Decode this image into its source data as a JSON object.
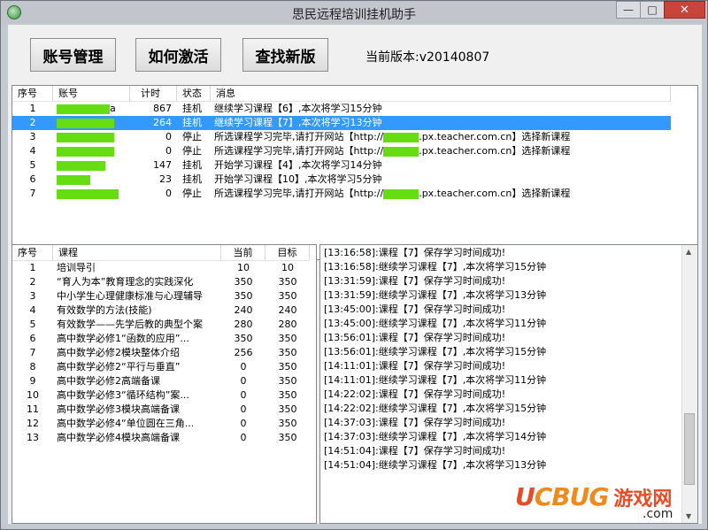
{
  "window": {
    "title": "思民远程培训挂机助手",
    "min_glyph": "—",
    "max_glyph": "□",
    "close_glyph": "✕"
  },
  "toolbar": {
    "account_button": "账号管理",
    "activate_button": "如何激活",
    "update_button": "查找新版",
    "version_label": "当前版本:v20140807"
  },
  "accounts": {
    "headers": [
      "序号",
      "账号",
      "计时",
      "状态",
      "消息"
    ],
    "rows": [
      {
        "no": "1",
        "account_suffix": "a",
        "timer": "867",
        "status": "挂机",
        "message": "继续学习课程【6】,本次将学习15分钟",
        "selected": false
      },
      {
        "no": "2",
        "account_suffix": "",
        "timer": "264",
        "status": "挂机",
        "message": "继续学习课程【7】,本次将学习13分钟",
        "selected": true
      },
      {
        "no": "3",
        "account_suffix": "",
        "timer": "0",
        "status": "停止",
        "message": "所选课程学习完毕,请打开网站【http://          .px.teacher.com.cn】选择新课程",
        "selected": false
      },
      {
        "no": "4",
        "account_suffix": "",
        "timer": "0",
        "status": "停止",
        "message": "所选课程学习完毕,请打开网站【http://          .px.teacher.com.cn】选择新课程",
        "selected": false
      },
      {
        "no": "5",
        "account_suffix": "",
        "timer": "147",
        "status": "挂机",
        "message": "开始学习课程【4】,本次将学习14分钟",
        "selected": false
      },
      {
        "no": "6",
        "account_suffix": "",
        "timer": "23",
        "status": "挂机",
        "message": "开始学习课程【10】,本次将学习5分钟",
        "selected": false
      },
      {
        "no": "7",
        "account_suffix": "",
        "timer": "0",
        "status": "停止",
        "message": "所选课程学习完毕,请打开网站【http://          .px.teacher.com.cn】选择新课程",
        "selected": false
      }
    ]
  },
  "courses": {
    "headers": [
      "序号",
      "课程",
      "当前",
      "目标"
    ],
    "rows": [
      {
        "no": "1",
        "name": "培训导引",
        "current": "10",
        "target": "10"
      },
      {
        "no": "2",
        "name": "“育人为本”教育理念的实践深化",
        "current": "350",
        "target": "350"
      },
      {
        "no": "3",
        "name": "中小学生心理健康标准与心理辅导",
        "current": "350",
        "target": "350"
      },
      {
        "no": "4",
        "name": "有效数学的方法(技能)",
        "current": "240",
        "target": "240"
      },
      {
        "no": "5",
        "name": "有效数学——先学后教的典型个案",
        "current": "280",
        "target": "280"
      },
      {
        "no": "6",
        "name": "高中数学必修1“函数的应用”...",
        "current": "350",
        "target": "350"
      },
      {
        "no": "7",
        "name": "高中数学必修2模块整体介绍",
        "current": "256",
        "target": "350"
      },
      {
        "no": "8",
        "name": "高中数学必修2“平行与垂直”",
        "current": "0",
        "target": "350"
      },
      {
        "no": "9",
        "name": "高中数学必修2高端备课",
        "current": "0",
        "target": "350"
      },
      {
        "no": "10",
        "name": "高中数学必修3“循环结构”案...",
        "current": "0",
        "target": "350"
      },
      {
        "no": "11",
        "name": "高中数学必修3模块高端备课",
        "current": "0",
        "target": "350"
      },
      {
        "no": "12",
        "name": "高中数学必修4“单位圆在三角...",
        "current": "0",
        "target": "350"
      },
      {
        "no": "13",
        "name": "高中数学必修4模块高端备课",
        "current": "0",
        "target": "350"
      }
    ]
  },
  "log": {
    "lines": [
      "[13:16:58]:课程【7】保存学习时间成功!",
      "[13:16:58]:继续学习课程【7】,本次将学习15分钟",
      "[13:31:59]:课程【7】保存学习时间成功!",
      "[13:31:59]:继续学习课程【7】,本次将学习13分钟",
      "[13:45:00]:课程【7】保存学习时间成功!",
      "[13:45:00]:继续学习课程【7】,本次将学习11分钟",
      "[13:56:01]:课程【7】保存学习时间成功!",
      "[13:56:01]:继续学习课程【7】,本次将学习15分钟",
      "[14:11:01]:课程【7】保存学习时间成功!",
      "[14:11:01]:继续学习课程【7】,本次将学习11分钟",
      "[14:22:02]:课程【7】保存学习时间成功!",
      "[14:22:02]:继续学习课程【7】,本次将学习15分钟",
      "[14:37:03]:课程【7】保存学习时间成功!",
      "[14:37:03]:继续学习课程【7】,本次将学习14分钟",
      "[14:51:04]:课程【7】保存学习时间成功!",
      "[14:51:04]:继续学习课程【7】,本次将学习13分钟"
    ],
    "scroll_up_glyph": "▲",
    "scroll_down_glyph": "▼"
  },
  "watermark": {
    "logo_u": "U",
    "logo_rest": "CBUG",
    "cn": "游戏网",
    "com": ".com"
  },
  "colors": {
    "selection": "#3399ff",
    "mask": "#66dd11",
    "close": "#c9443b",
    "watermark": "#f08a1c"
  }
}
